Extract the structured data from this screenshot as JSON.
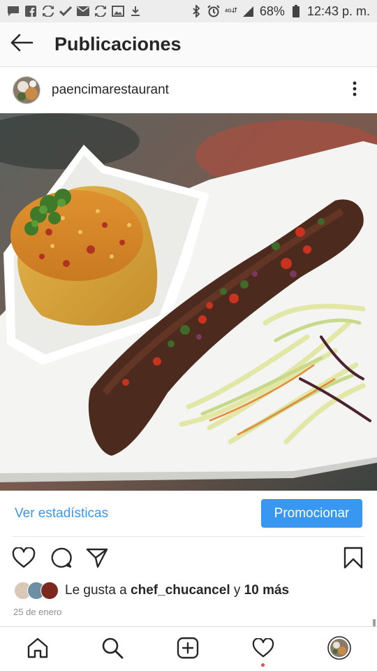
{
  "status_bar": {
    "battery": "68%",
    "time": "12:43 p. m.",
    "network": "4G",
    "left_icons": [
      "message-icon",
      "facebook-icon",
      "sync-icon",
      "check-icon",
      "mail-icon",
      "sync-icon",
      "image-icon",
      "download-icon"
    ],
    "right_icons": [
      "bluetooth-icon",
      "alarm-icon",
      "network-4g-icon",
      "signal-icon",
      "battery-icon"
    ]
  },
  "header": {
    "title": "Publicaciones",
    "back_icon": "arrow-left-icon"
  },
  "post": {
    "username": "paencimarestaurant",
    "more_icon": "more-vertical-icon",
    "image_subject": "food-plate-photo"
  },
  "stats": {
    "link": "Ver estadísticas",
    "promote_button": "Promocionar"
  },
  "actions": {
    "icons": [
      "heart-icon",
      "comment-icon",
      "share-icon",
      "bookmark-icon"
    ]
  },
  "likes": {
    "prefix": "Le gusta a ",
    "user": "chef_chucancel",
    "middle": " y ",
    "count": "10 más"
  },
  "date": "25 de enero",
  "bottom_nav": {
    "items": [
      "home-icon",
      "search-icon",
      "add-post-icon",
      "activity-heart-icon",
      "profile-avatar-icon"
    ]
  },
  "colors": {
    "accent": "#3897f0",
    "notification_dot": "#ed4956",
    "text": "#262626",
    "muted": "#8e8e8e"
  }
}
